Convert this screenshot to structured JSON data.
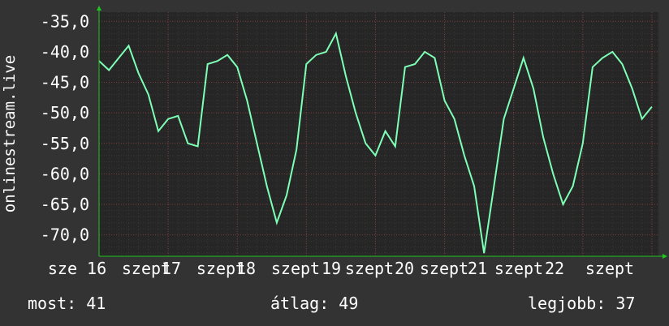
{
  "ylabel": "onlinestream.live",
  "y_ticks": [
    "-35,0",
    "-40,0",
    "-45,0",
    "-50,0",
    "-55,0",
    "-60,0",
    "-65,0",
    "-70,0"
  ],
  "x_ticks": [
    "sze 16",
    "szept",
    "17",
    "szept",
    "18",
    "szept",
    "19",
    "szept",
    "20",
    "szept",
    "21",
    "szept",
    "22",
    "szept"
  ],
  "stats": {
    "now": "most: 41",
    "avg": "átlag: 49",
    "best": "legjobb: 37"
  },
  "colors": {
    "background": "#333333",
    "plot": "#262626",
    "line": "#7dffb6",
    "grid": "#7a3b3b",
    "axis_arrow": "#1fc61f"
  },
  "chart_data": {
    "type": "line",
    "x": [
      0,
      3,
      6,
      9,
      12,
      15,
      18,
      21,
      24,
      27,
      30,
      33,
      36,
      39,
      42,
      45,
      48,
      51,
      54,
      57,
      60,
      63,
      66,
      69,
      72,
      75,
      78,
      81,
      84,
      87,
      90,
      93,
      96,
      99,
      102,
      105,
      108,
      111,
      114,
      117,
      120,
      123,
      126,
      129,
      132,
      135,
      138,
      141,
      144,
      147,
      150,
      153,
      156,
      159,
      162,
      165,
      168
    ],
    "values": [
      -41.5,
      -43.0,
      -41.0,
      -39.0,
      -43.5,
      -47.0,
      -53.0,
      -51.0,
      -50.5,
      -55.0,
      -55.5,
      -42.0,
      -41.5,
      -40.5,
      -42.5,
      -48.0,
      -55.0,
      -62.0,
      -68.0,
      -63.5,
      -56.0,
      -42.0,
      -40.5,
      -40.0,
      -37.0,
      -44.0,
      -50.0,
      -55.0,
      -57.0,
      -53.0,
      -55.5,
      -42.5,
      -42.0,
      -40.0,
      -41.0,
      -48.0,
      -51.0,
      -57.0,
      -62.0,
      -73.0,
      -62.0,
      -51.0,
      -46.0,
      -41.0,
      -46.0,
      -54.0,
      -60.0,
      -65.0,
      -62.0,
      -55.0,
      -42.5,
      -41.0,
      -40.0,
      -42.0,
      -46.0,
      -51.0,
      -49.0
    ],
    "ylim": [
      -73.5,
      -33.5
    ],
    "xlim": [
      0,
      170
    ],
    "grid": true
  }
}
